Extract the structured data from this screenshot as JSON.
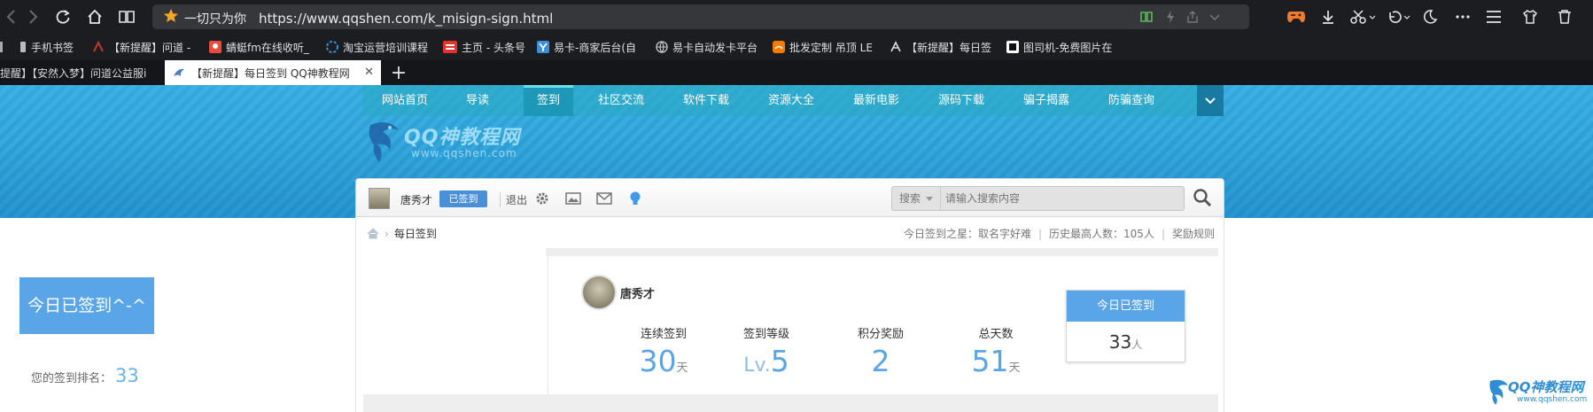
{
  "browser": {
    "address": {
      "prefix": "一切只为你",
      "url": "https://www.qqshen.com/k_misign-sign.html"
    },
    "bookmarks": [
      {
        "label": "手机书签"
      },
      {
        "label": "【新提醒】问道 -"
      },
      {
        "label": "蜻蜓fm在线收听_"
      },
      {
        "label": "淘宝运营培训课程"
      },
      {
        "label": "主页 - 头条号"
      },
      {
        "label": "易卡-商家后台(自"
      },
      {
        "label": "易卡自动发卡平台"
      },
      {
        "label": "批发定制 吊顶 LE"
      },
      {
        "label": "【新提醒】每日签"
      },
      {
        "label": "图司机-免费图片在"
      }
    ],
    "tabs": [
      {
        "label": "提醒】【安然入梦】问道公益服i"
      },
      {
        "label": "【新提醒】每日签到 QQ神教程网"
      }
    ],
    "new_tab": "+",
    "close_tab": "✕"
  },
  "site": {
    "nav": [
      "网站首页",
      "导读",
      "签到",
      "社区交流",
      "软件下载",
      "资源大全",
      "最新电影",
      "源码下载",
      "骗子揭露",
      "防骗查询"
    ],
    "nav_active": "签到",
    "logo_text": "QQ神教程网",
    "logo_url": "www.qqshen.com",
    "user": {
      "name": "唐秀才",
      "signed_badge": "已签到",
      "logout": "退出"
    },
    "search": {
      "select": "搜索",
      "placeholder": "请输入搜索内容"
    },
    "breadcrumb": {
      "current": "每日签到"
    },
    "stats": {
      "star": "今日签到之星：取名字好难",
      "record": "历史最高人数：105人",
      "rules": "奖励规则"
    }
  },
  "sign": {
    "button": "今日已签到^-^",
    "rank_label": "您的签到排名：",
    "rank_value": "33",
    "username": "唐秀才",
    "items": [
      {
        "label": "连续签到",
        "value": "30",
        "unit": "天"
      },
      {
        "label": "签到等级",
        "value": "5",
        "prefix": "Lv.",
        "unit": ""
      },
      {
        "label": "积分奖励",
        "value": "2",
        "unit": ""
      },
      {
        "label": "总天数",
        "value": "51",
        "unit": "天"
      }
    ],
    "today": {
      "title": "今日已签到",
      "count": "33",
      "unit": "人"
    }
  },
  "corner_logo": {
    "name": "QQ神教程网",
    "url": "www.qqshen.com"
  },
  "colors": {
    "accent": "#5aa5e8",
    "banner": "#2d9fd6",
    "chrome": "#1c1d21"
  }
}
